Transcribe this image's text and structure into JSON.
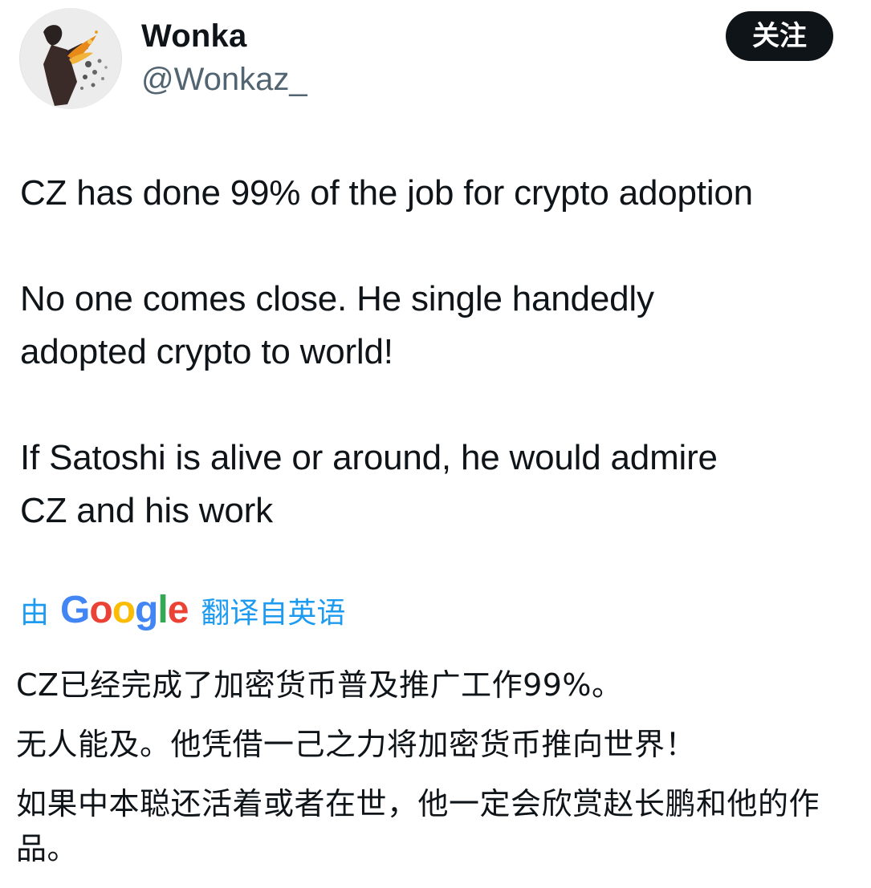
{
  "author": {
    "display_name": "Wonka",
    "handle": "@Wonkaz_"
  },
  "follow_button": {
    "label": "关注"
  },
  "tweet": {
    "paragraphs": [
      "CZ has done 99% of the job for crypto adoption",
      "No one comes close. He single handedly\nadopted crypto to world!",
      "If Satoshi is alive or around, he would admire\nCZ and his work"
    ]
  },
  "translation": {
    "prefix": "由",
    "provider": "Google",
    "suffix": "翻译自英语",
    "paragraphs": [
      "CZ已经完成了加密货币普及推广工作99%。",
      "无人能及。他凭借一己之力将加密货币推向世界！",
      "如果中本聪还活着或者在世，他一定会欣赏赵长鹏和他的作品。"
    ]
  },
  "colors": {
    "text": "#0f1419",
    "secondary_text": "#536471",
    "link": "#1d9bf0",
    "button_bg": "#0f1419",
    "button_text": "#ffffff"
  }
}
